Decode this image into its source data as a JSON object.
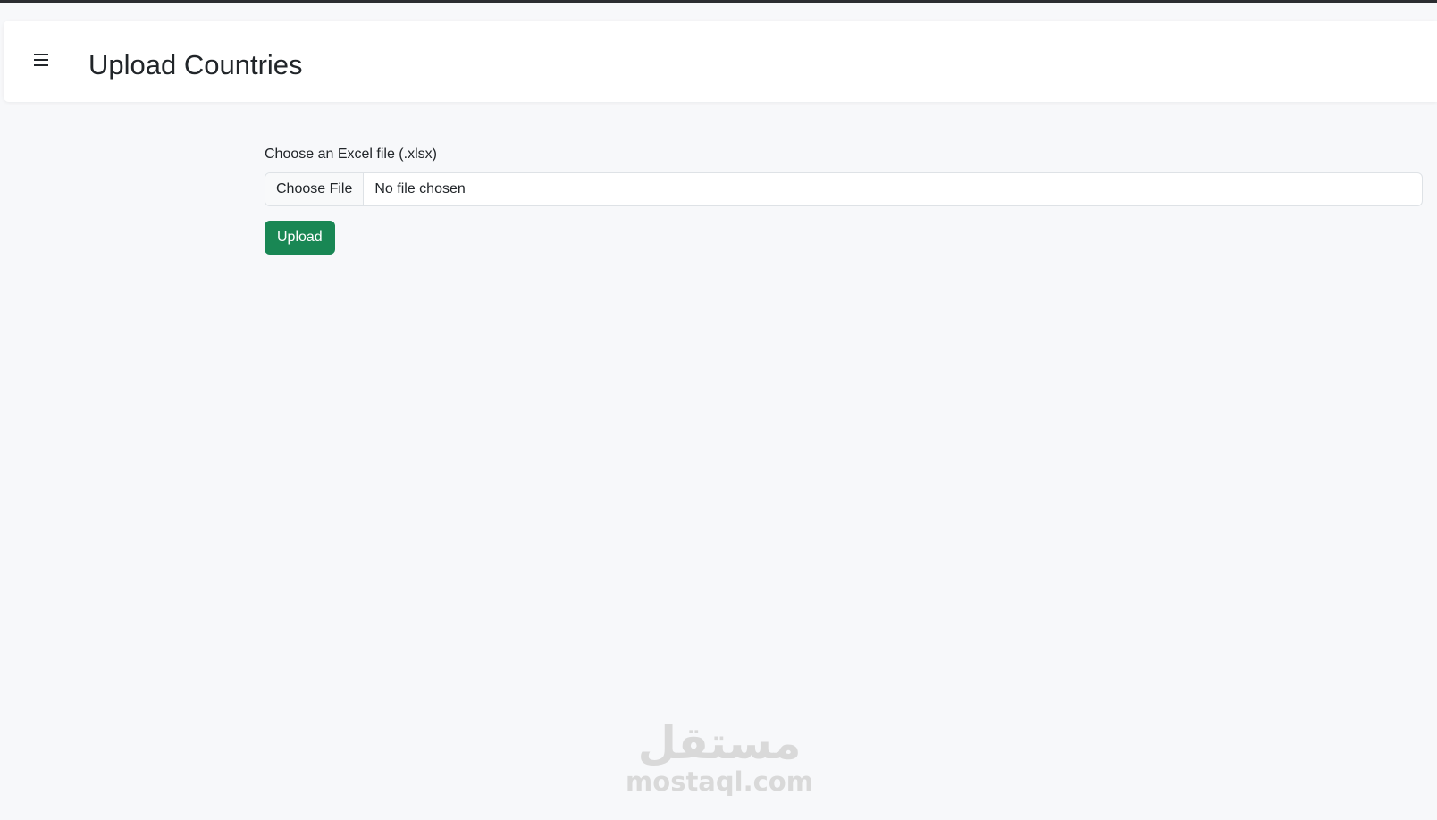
{
  "header": {
    "title": "Upload Countries",
    "menu_icon": "hamburger-menu-icon"
  },
  "form": {
    "label": "Choose an Excel file (.xlsx)",
    "file_button_label": "Choose File",
    "file_status": "No file chosen",
    "submit_label": "Upload"
  },
  "watermark": {
    "arabic": "مستقل",
    "latin": "mostaql.com"
  },
  "colors": {
    "primary_button": "#198754",
    "page_background": "#f7f8fa",
    "header_background": "#ffffff"
  }
}
